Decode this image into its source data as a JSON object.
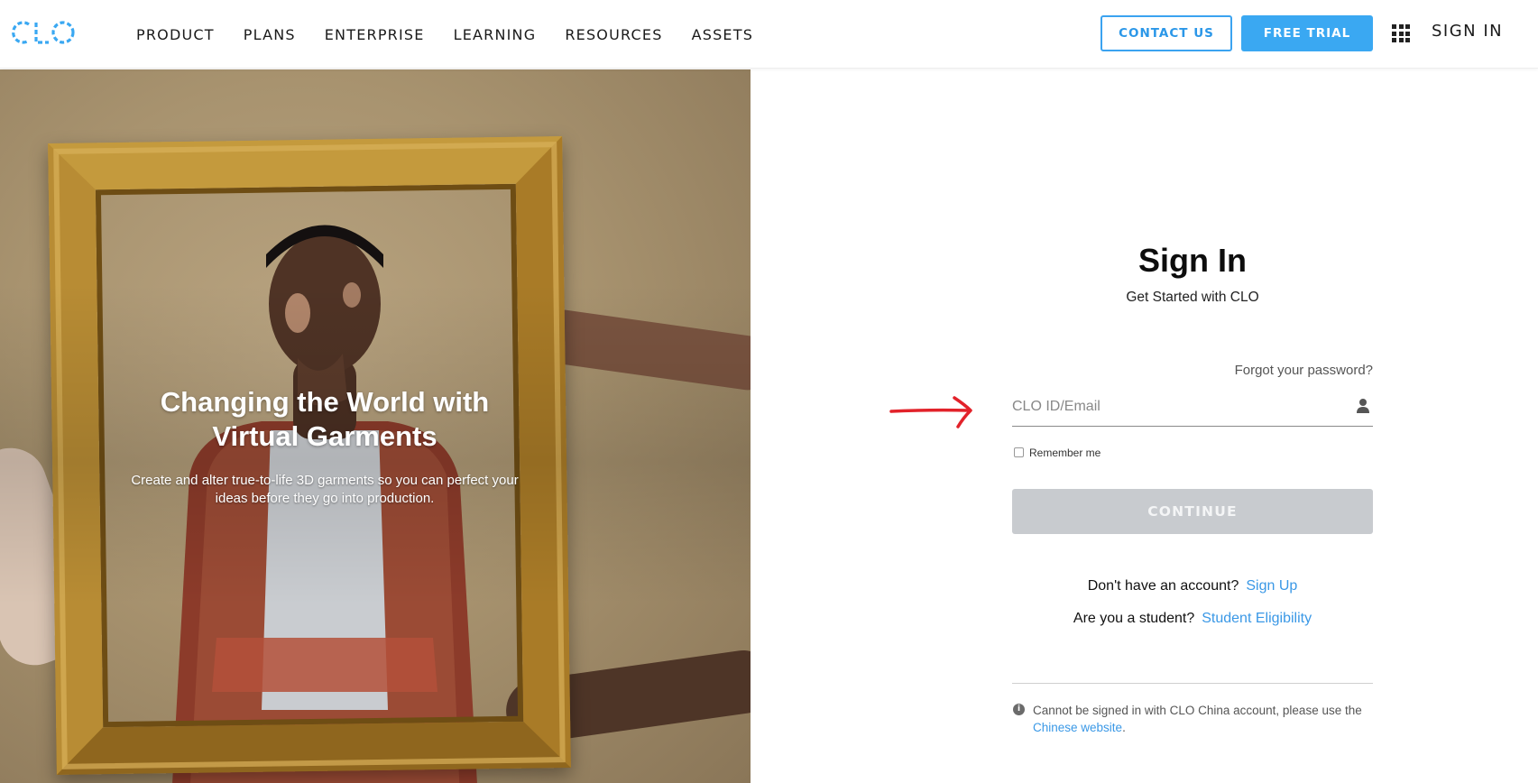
{
  "header": {
    "logo_text": "CLO",
    "nav": [
      "PRODUCT",
      "PLANS",
      "ENTERPRISE",
      "LEARNING",
      "RESOURCES",
      "ASSETS"
    ],
    "contact_label": "CONTACT US",
    "trial_label": "FREE TRIAL",
    "signin_label": "SIGN IN"
  },
  "hero": {
    "title_line1": "Changing the World with",
    "title_line2": "Virtual Garments",
    "subtitle_line1": "Create and alter true-to-life 3D garments so you can perfect your",
    "subtitle_line2": "ideas before they go into production."
  },
  "signin": {
    "title": "Sign In",
    "subtitle": "Get Started with CLO",
    "forgot_label": "Forgot your password?",
    "email_placeholder": "CLO ID/Email",
    "email_value": "",
    "remember_label": "Remember me",
    "remember_checked": false,
    "continue_label": "CONTINUE",
    "signup_prompt": "Don't have an account?",
    "signup_link": "Sign Up",
    "student_prompt": "Are you a student?",
    "student_link": "Student Eligibility",
    "note_text": "Cannot be signed in with CLO China account, please use the",
    "note_link": "Chinese website",
    "note_end": "."
  },
  "colors": {
    "accent": "#3aa8f2",
    "link": "#3a98e6",
    "continue_disabled": "#c8cbcf",
    "annotation_arrow": "#e2222a"
  },
  "icons": {
    "apps": "grid-icon",
    "user": "person-icon",
    "info": "info-icon",
    "annotation": "red-arrow-icon"
  }
}
